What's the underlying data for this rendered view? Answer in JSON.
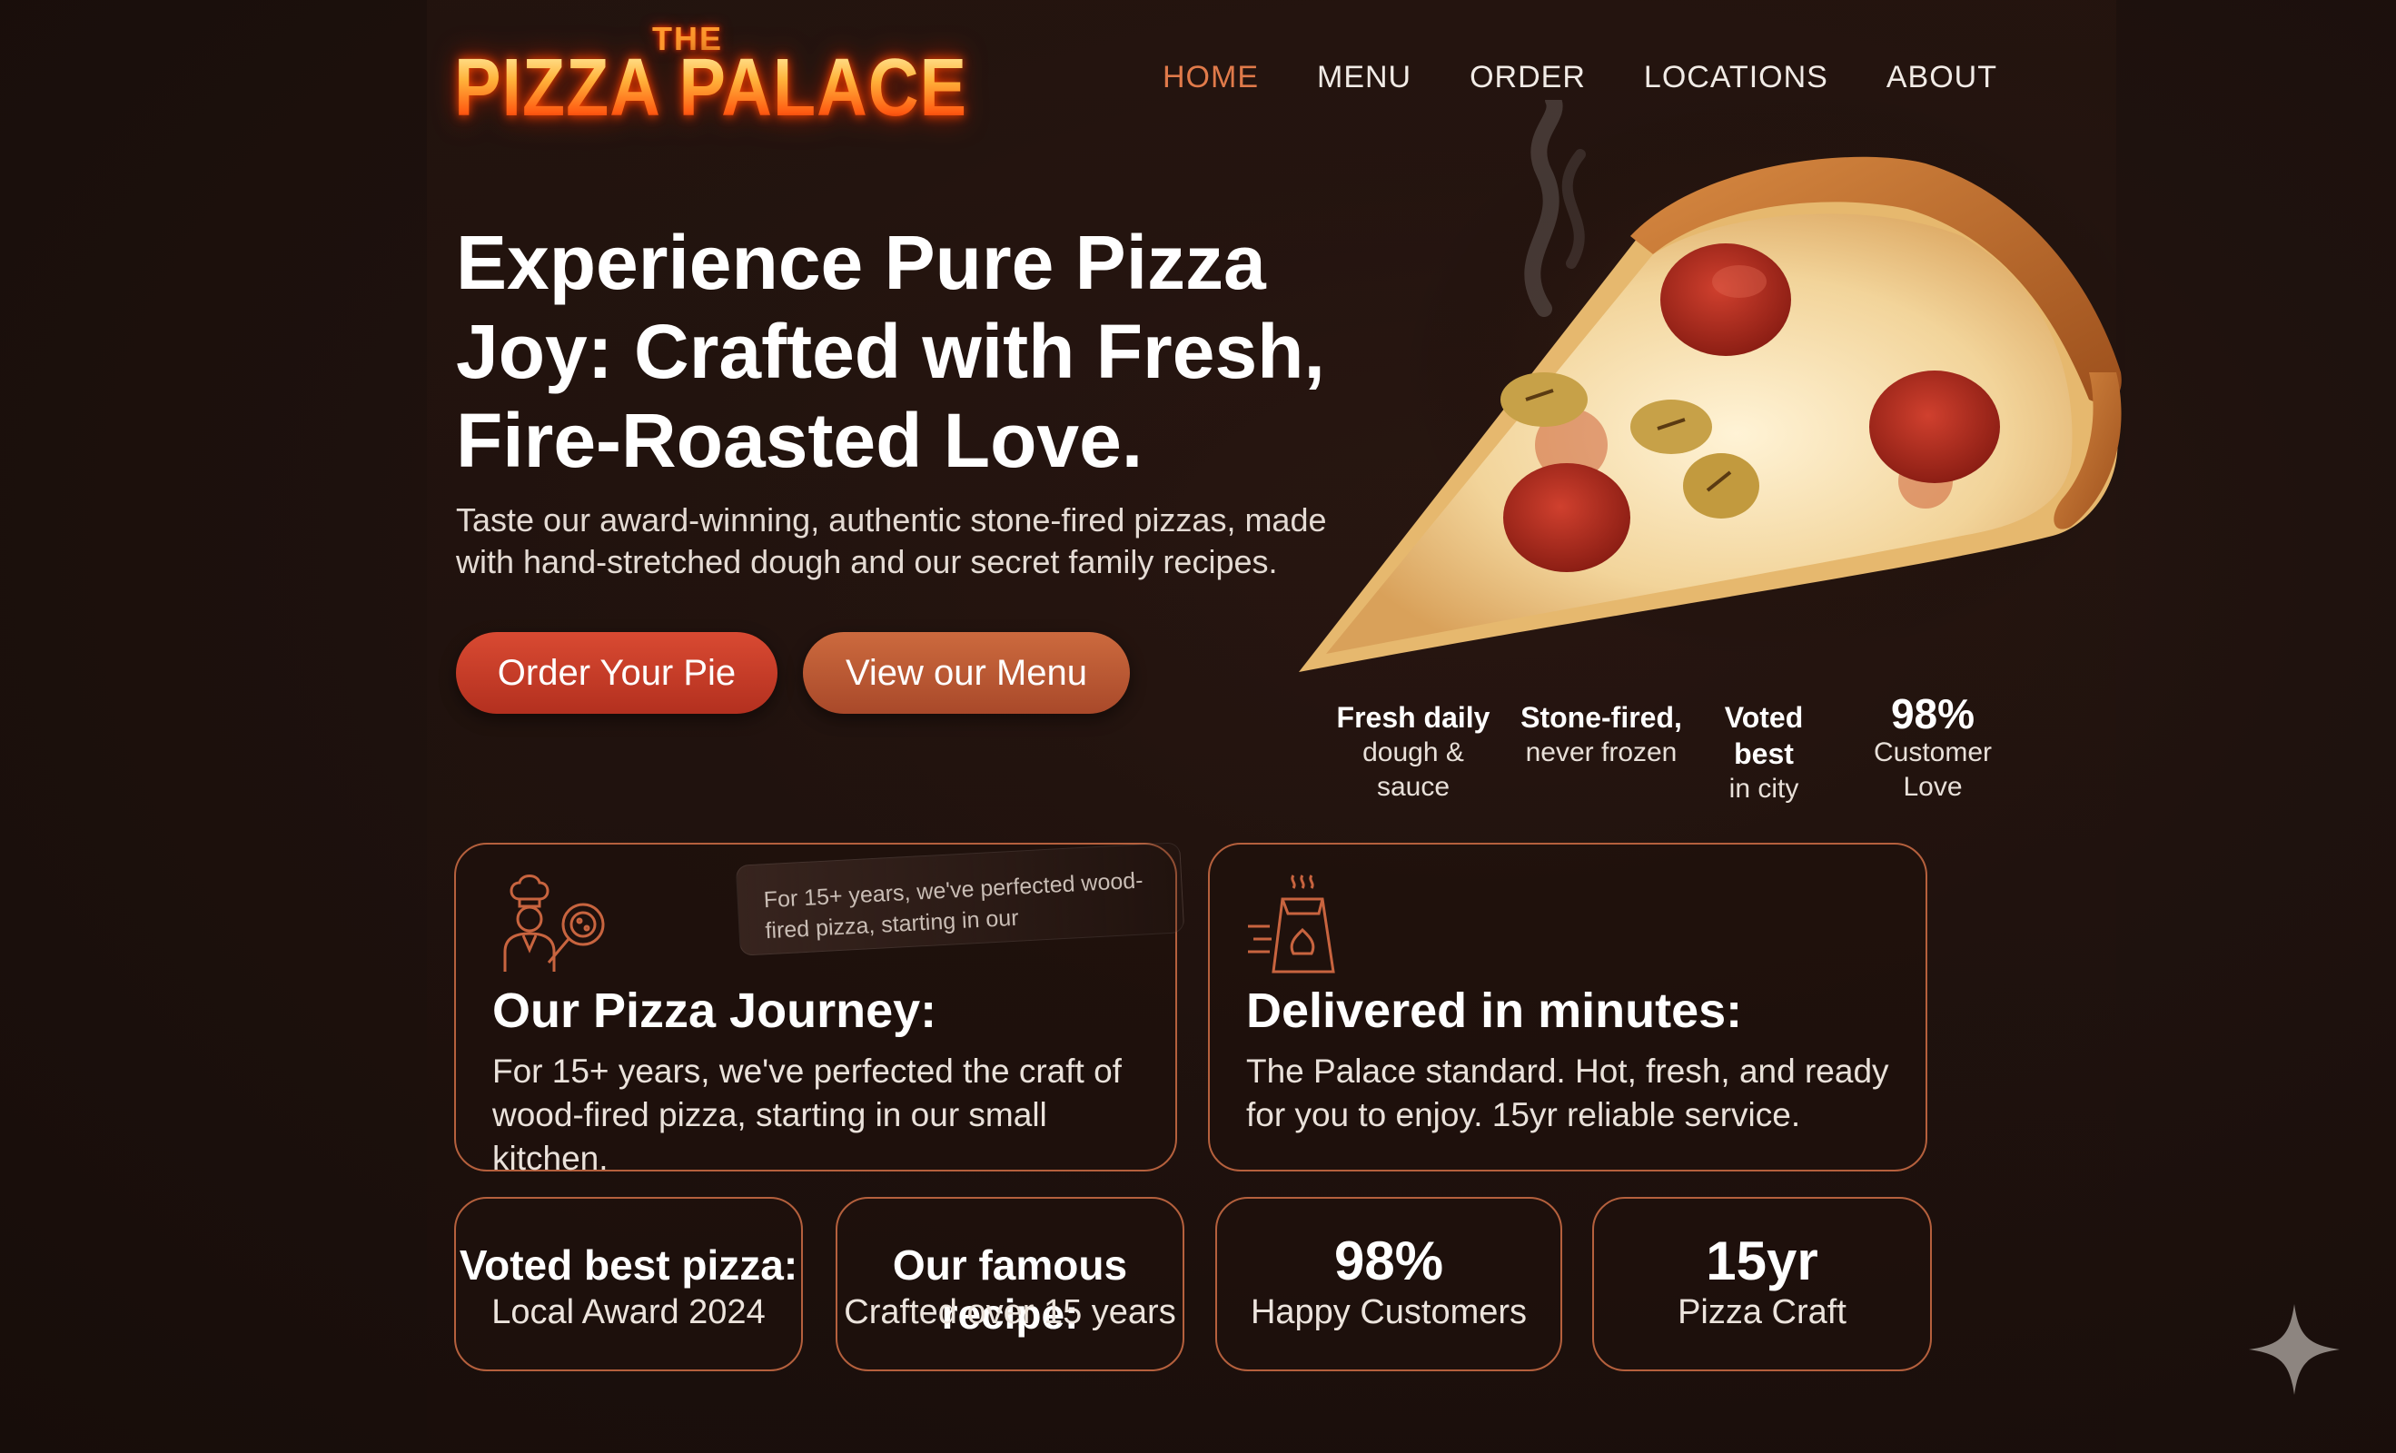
{
  "logo": {
    "the": "THE",
    "main": "PIZZA PALACE"
  },
  "nav": {
    "home": "HOME",
    "menu": "MENU",
    "order": "ORDER",
    "locations": "LOCATIONS",
    "about": "ABOUT"
  },
  "hero": {
    "title": "Experience Pure Pizza Joy: Crafted with Fresh, Fire-Roasted Love.",
    "subtitle": "Taste our award-winning, authentic stone-fired pizzas, made with hand-stretched dough and our secret family recipes.",
    "order_button": "Order Your Pie",
    "menu_button": "View our Menu"
  },
  "highlights": {
    "fresh_bold": "Fresh daily",
    "fresh_text": "dough & sauce",
    "stone_bold": "Stone-fired,",
    "stone_text": "never frozen",
    "voted_bold": "Voted best",
    "voted_text": "in city",
    "love_value": "98%",
    "love_text": "Customer Love"
  },
  "journey": {
    "title": "Our Pizza Journey:",
    "text": "For 15+ years, we've perfected the craft of wood-fired pizza, starting in our small kitchen.",
    "tooltip": "For 15+ years, we've perfected wood-fired pizza, starting in our"
  },
  "delivery": {
    "title": "Delivered in minutes:",
    "text": "The Palace standard. Hot, fresh, and ready for you to enjoy. 15yr reliable service."
  },
  "stats": {
    "award_title": "Voted best pizza:",
    "award_text": "Local Award 2024",
    "recipe_title": "Our famous recipe:",
    "recipe_text": "Crafted over 15 years",
    "customers_value": "98%",
    "customers_text": "Happy Customers",
    "craft_value": "15yr",
    "craft_text": "Pizza Craft"
  },
  "colors": {
    "accent": "#e07a4a",
    "border": "#b5603d",
    "btn_red": "#c93c28",
    "btn_orange": "#bb5934"
  },
  "icons": [
    "chef-icon",
    "delivery-bag-icon",
    "sparkle-icon"
  ]
}
